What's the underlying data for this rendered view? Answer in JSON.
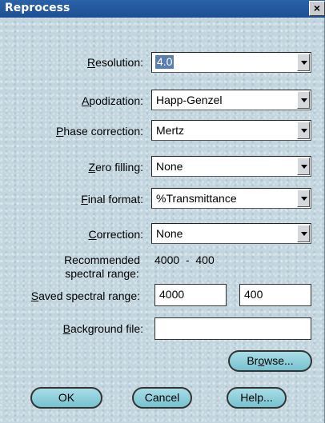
{
  "window": {
    "title": "Reprocess",
    "close_symbol": "×"
  },
  "fields": {
    "resolution": {
      "label_key": "R",
      "label_rest": "esolution:",
      "value": "4.0"
    },
    "apodization": {
      "label_key": "A",
      "label_rest": "podization:",
      "value": "Happ-Genzel"
    },
    "phase_correction": {
      "label_key": "P",
      "label_rest": "hase correction:",
      "value": "Mertz"
    },
    "zero_filling": {
      "label_key": "Z",
      "label_rest": "ero filling:",
      "value": "None"
    },
    "final_format": {
      "label_key": "F",
      "label_rest": "inal format:",
      "value": "%Transmittance"
    },
    "correction": {
      "label_key": "C",
      "label_rest": "orrection:",
      "value": "None"
    }
  },
  "recommended": {
    "label_line1": "Recommended",
    "label_line2": "spectral range:",
    "value": "4000  -  400"
  },
  "saved_range": {
    "label_key": "S",
    "label_rest": "aved spectral range:",
    "from": "4000",
    "to": "400"
  },
  "background": {
    "label_key": "B",
    "label_rest": "ackground file:",
    "value": ""
  },
  "buttons": {
    "browse_pre": "Br",
    "browse_key": "o",
    "browse_post": "wse...",
    "ok": "OK",
    "cancel": "Cancel",
    "help": "Help..."
  }
}
